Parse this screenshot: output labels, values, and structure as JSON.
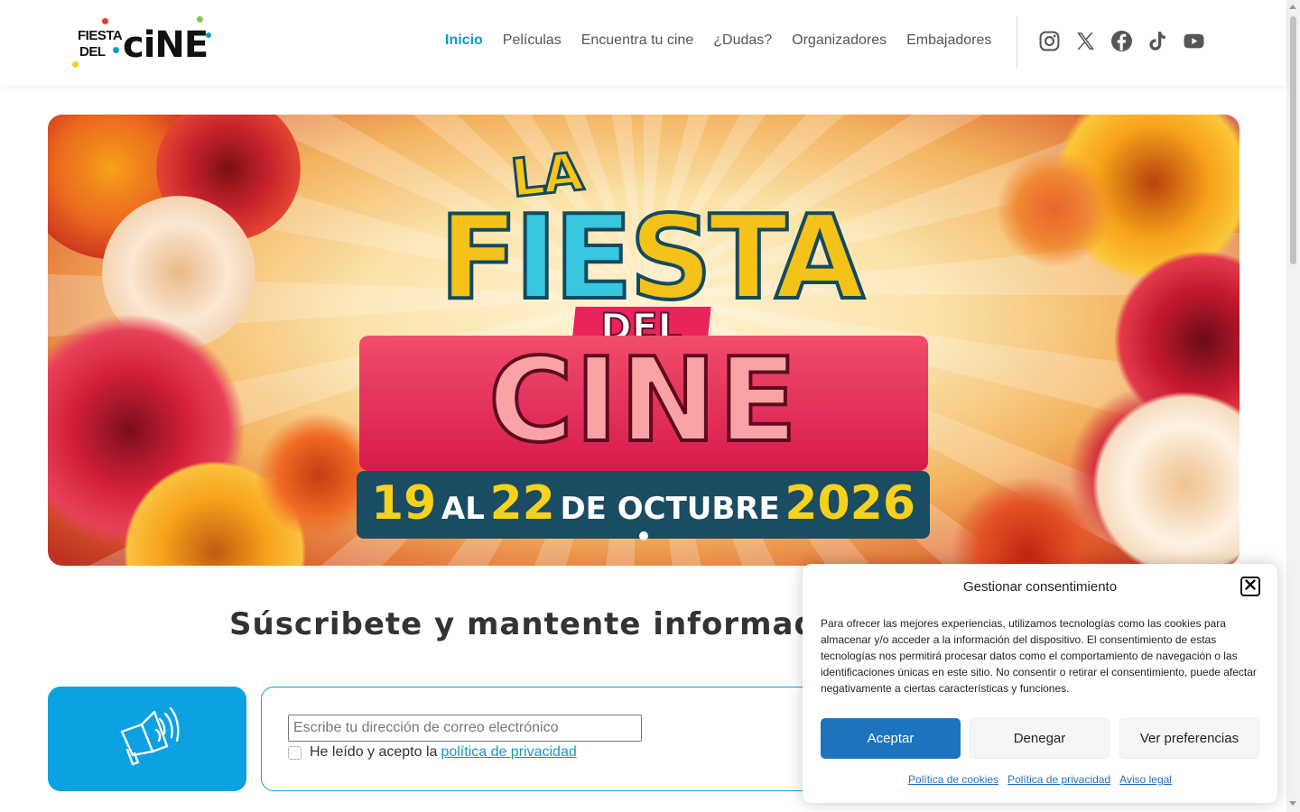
{
  "logo": {
    "line1": "FIESTA",
    "line2": "DEL",
    "word": "ciNE"
  },
  "nav": {
    "items": [
      {
        "label": "Inicio",
        "active": true
      },
      {
        "label": "Películas"
      },
      {
        "label": "Encuentra tu cine"
      },
      {
        "label": "¿Dudas?"
      },
      {
        "label": "Organizadores"
      },
      {
        "label": "Embajadores"
      }
    ]
  },
  "social": [
    "instagram-icon",
    "x-icon",
    "facebook-icon",
    "tiktok-icon",
    "youtube-icon"
  ],
  "banner": {
    "la": "LA",
    "fiesta_f": "F",
    "fiesta_ie": "IE",
    "fiesta_rest": "STA",
    "del": "DEL",
    "cine": "CINE",
    "date_d1": "19",
    "date_al": "AL",
    "date_d2": "22",
    "date_de": "DE OCTUBRE",
    "date_year": "2026",
    "prev_icon": "arrow-left-icon",
    "next_icon": "arrow-right-icon"
  },
  "subscribe": {
    "title": "Súscribete y mantente informado de",
    "email_placeholder": "Escribe tu dirección de correo electrónico",
    "consent_prefix": "He leído y acepto la",
    "privacy_link": "política de privacidad"
  },
  "consent": {
    "title": "Gestionar consentimiento",
    "text": "Para ofrecer las mejores experiencias, utilizamos tecnologías como las cookies para almacenar y/o acceder a la información del dispositivo. El consentimiento de estas tecnologías nos permitirá procesar datos como el comportamiento de navegación o las identificaciones únicas en este sitio. No consentir o retirar el consentimiento, puede afectar negativamente a ciertas características y funciones.",
    "accept": "Aceptar",
    "deny": "Denegar",
    "preferences": "Ver preferencias",
    "links": [
      "Política de cookies",
      "Política de privacidad",
      "Aviso legal"
    ]
  },
  "colors": {
    "accent": "#1596c9",
    "accept_button": "#1e73be",
    "megaphone_box": "#0ba1e2"
  }
}
